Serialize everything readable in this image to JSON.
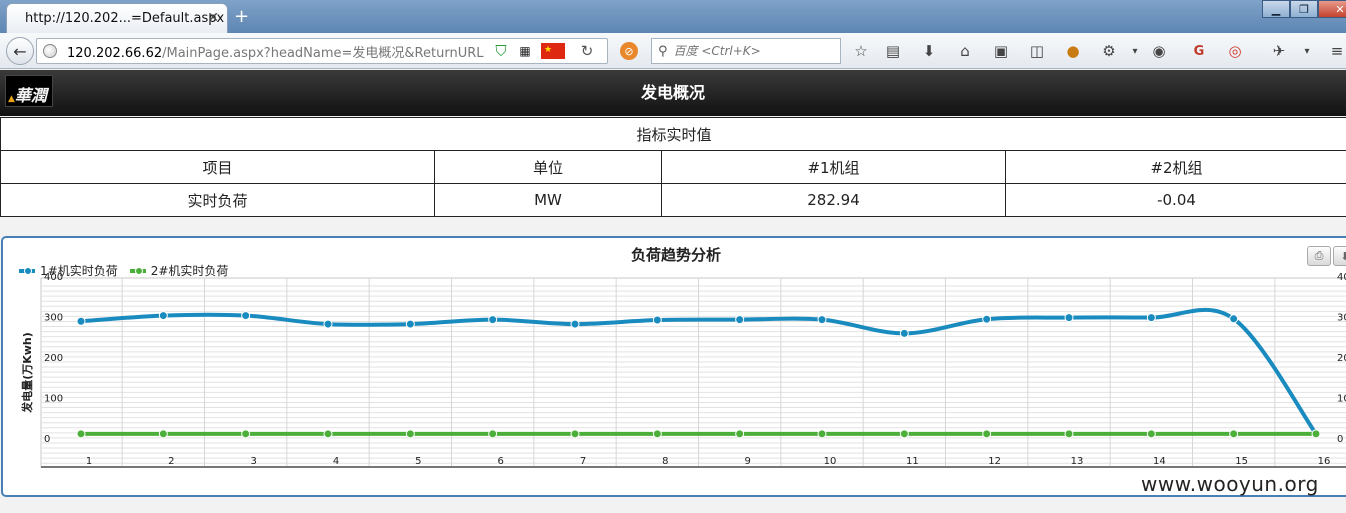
{
  "browser": {
    "tab_title": "http://120.202...=Default.aspx",
    "url_host": "120.202.66.62",
    "url_path": "/MainPage.aspx?headName=发电概况&ReturnURL=Defa",
    "search_placeholder": "百度 <Ctrl+K>"
  },
  "header": {
    "logo_text": "華潤",
    "title": "发电概况"
  },
  "realtime_table": {
    "caption": "指标实时值",
    "columns": [
      "项目",
      "单位",
      "#1机组",
      "#2机组"
    ],
    "rows": [
      [
        "实时负荷",
        "MW",
        "282.94",
        "-0.04"
      ]
    ]
  },
  "chart_data": {
    "type": "line",
    "title": "负荷趋势分析",
    "ylabel": "发电量(万Kwh)",
    "ylim": [
      0,
      400
    ],
    "yticks": [
      0,
      100,
      200,
      300,
      400
    ],
    "categories": [
      "1",
      "2",
      "3",
      "4",
      "5",
      "6",
      "7",
      "8",
      "9",
      "10",
      "11",
      "12",
      "13",
      "14",
      "15",
      "16"
    ],
    "series": [
      {
        "name": "1#机实时负荷",
        "color": "#1a8bbf",
        "values": [
          313,
          327,
          327,
          306,
          306,
          317,
          306,
          316,
          317,
          317,
          283,
          318,
          322,
          322,
          319,
          35
        ]
      },
      {
        "name": "2#机实时负荷",
        "color": "#4caf3a",
        "values": [
          35,
          35,
          35,
          35,
          35,
          35,
          35,
          35,
          35,
          35,
          35,
          35,
          35,
          35,
          35,
          35
        ]
      }
    ],
    "grid": true,
    "legend_position": "top-left"
  },
  "watermark": "www.wooyun.org",
  "colors": {
    "header_bg": "#1c1c1c",
    "panel_border": "#4a7fb5"
  }
}
